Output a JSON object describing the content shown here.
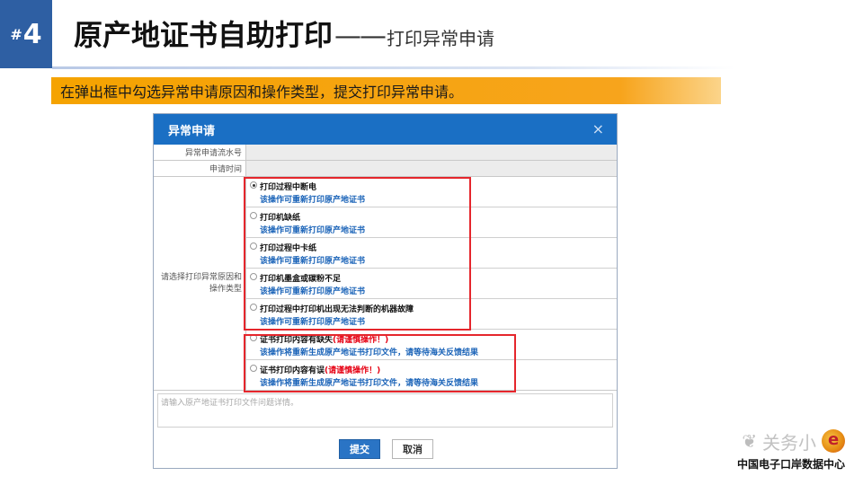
{
  "slide": {
    "badge_hash": "#",
    "badge_number": "4",
    "title_main": "原产地证书自助打印",
    "title_dash": "——",
    "title_sub": "打印异常申请"
  },
  "banner": {
    "text": "在弹出框中勾选异常申请原因和操作类型，提交打印异常申请。"
  },
  "dialog": {
    "title": "异常申请",
    "close_symbol": "×",
    "serial_label": "异常申请流水号",
    "serial_value": "",
    "time_label": "申请时间",
    "time_value": "",
    "reason_label": "请选择打印异常原因和操作类型",
    "options": [
      {
        "title": "打印过程中断电",
        "warning": "",
        "desc": "该操作可重新打印原产地证书",
        "checked": true
      },
      {
        "title": "打印机缺纸",
        "warning": "",
        "desc": "该操作可重新打印原产地证书",
        "checked": false
      },
      {
        "title": "打印过程中卡纸",
        "warning": "",
        "desc": "该操作可重新打印原产地证书",
        "checked": false
      },
      {
        "title": "打印机墨盒或碳粉不足",
        "warning": "",
        "desc": "该操作可重新打印原产地证书",
        "checked": false
      },
      {
        "title": "打印过程中打印机出现无法判断的机器故障",
        "warning": "",
        "desc": "该操作可重新打印原产地证书",
        "checked": false
      },
      {
        "title": "证书打印内容有缺失",
        "warning": "(请谨慎操作！)",
        "desc": "该操作将重新生成原产地证书打印文件，请等待海关反馈结果",
        "checked": false
      },
      {
        "title": "证书打印内容有误",
        "warning": "(请谨慎操作！)",
        "desc": "该操作将重新生成原产地证书打印文件，请等待海关反馈结果",
        "checked": false
      }
    ],
    "details_placeholder": "请输入原产地证书打印文件问题详情。",
    "submit_label": "提交",
    "cancel_label": "取消"
  },
  "watermark": {
    "name": "关务小",
    "subtitle": "中国电子口岸数据中心",
    "icon": "wechat-icon"
  },
  "colors": {
    "badge": "#2e5fa3",
    "banner": "#f5a300",
    "dialog_header": "#1a6fc4",
    "option_desc": "#1a63b8",
    "warning": "#e60012",
    "highlight_box": "#e5262c",
    "submit_button": "#2a74c5"
  }
}
